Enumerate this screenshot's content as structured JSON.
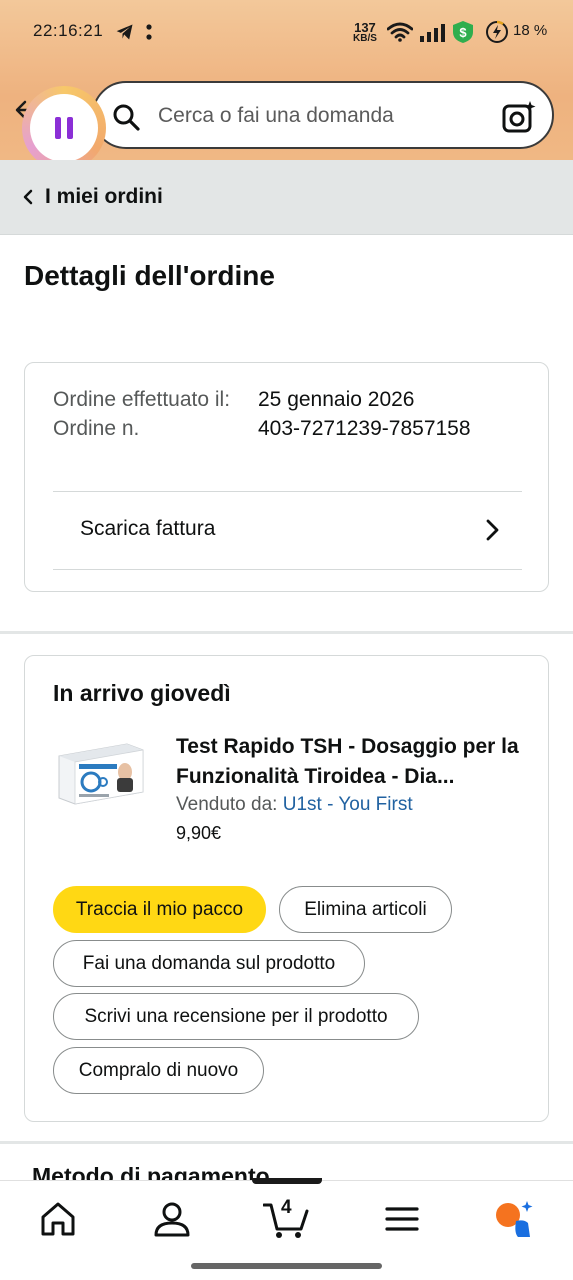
{
  "status_bar": {
    "time": "22:16:21",
    "speed_value": "137",
    "speed_unit": "KB/S",
    "battery_pct": "18 %"
  },
  "search": {
    "placeholder": "Cerca o fai una domanda"
  },
  "breadcrumb": {
    "label": "I miei ordini"
  },
  "page": {
    "title": "Dettagli dell'ordine"
  },
  "order_info": {
    "placed_label": "Ordine effettuato il:",
    "number_label": "Ordine n.",
    "placed_value": "25 gennaio 2026",
    "number_value": "403-7271239-7857158",
    "invoice_label": "Scarica fattura"
  },
  "delivery": {
    "title": "In arrivo giovedì",
    "product_title": "Test Rapido TSH - Dosaggio per la Funzionalità Tiroidea - Dia...",
    "sold_by_label": "Venduto da:",
    "seller": "U1st - You First",
    "price": "9,90€",
    "buttons": {
      "track": "Traccia il mio pacco",
      "delete": "Elimina articoli",
      "ask": "Fai una domanda sul prodotto",
      "review": "Scrivi una recensione per il prodotto",
      "buy_again": "Compralo di nuovo"
    }
  },
  "payment": {
    "title": "Metodo di pagamento"
  },
  "bottom_nav": {
    "cart_count": "4",
    "items": [
      "home-icon",
      "account-icon",
      "cart-icon",
      "menu-icon",
      "assistant-icon"
    ]
  },
  "colors": {
    "primary_button": "#ffd814",
    "link": "#2162a1",
    "header_gradient": "#f3c89a",
    "assistant_accent": "#8b2fd6"
  }
}
